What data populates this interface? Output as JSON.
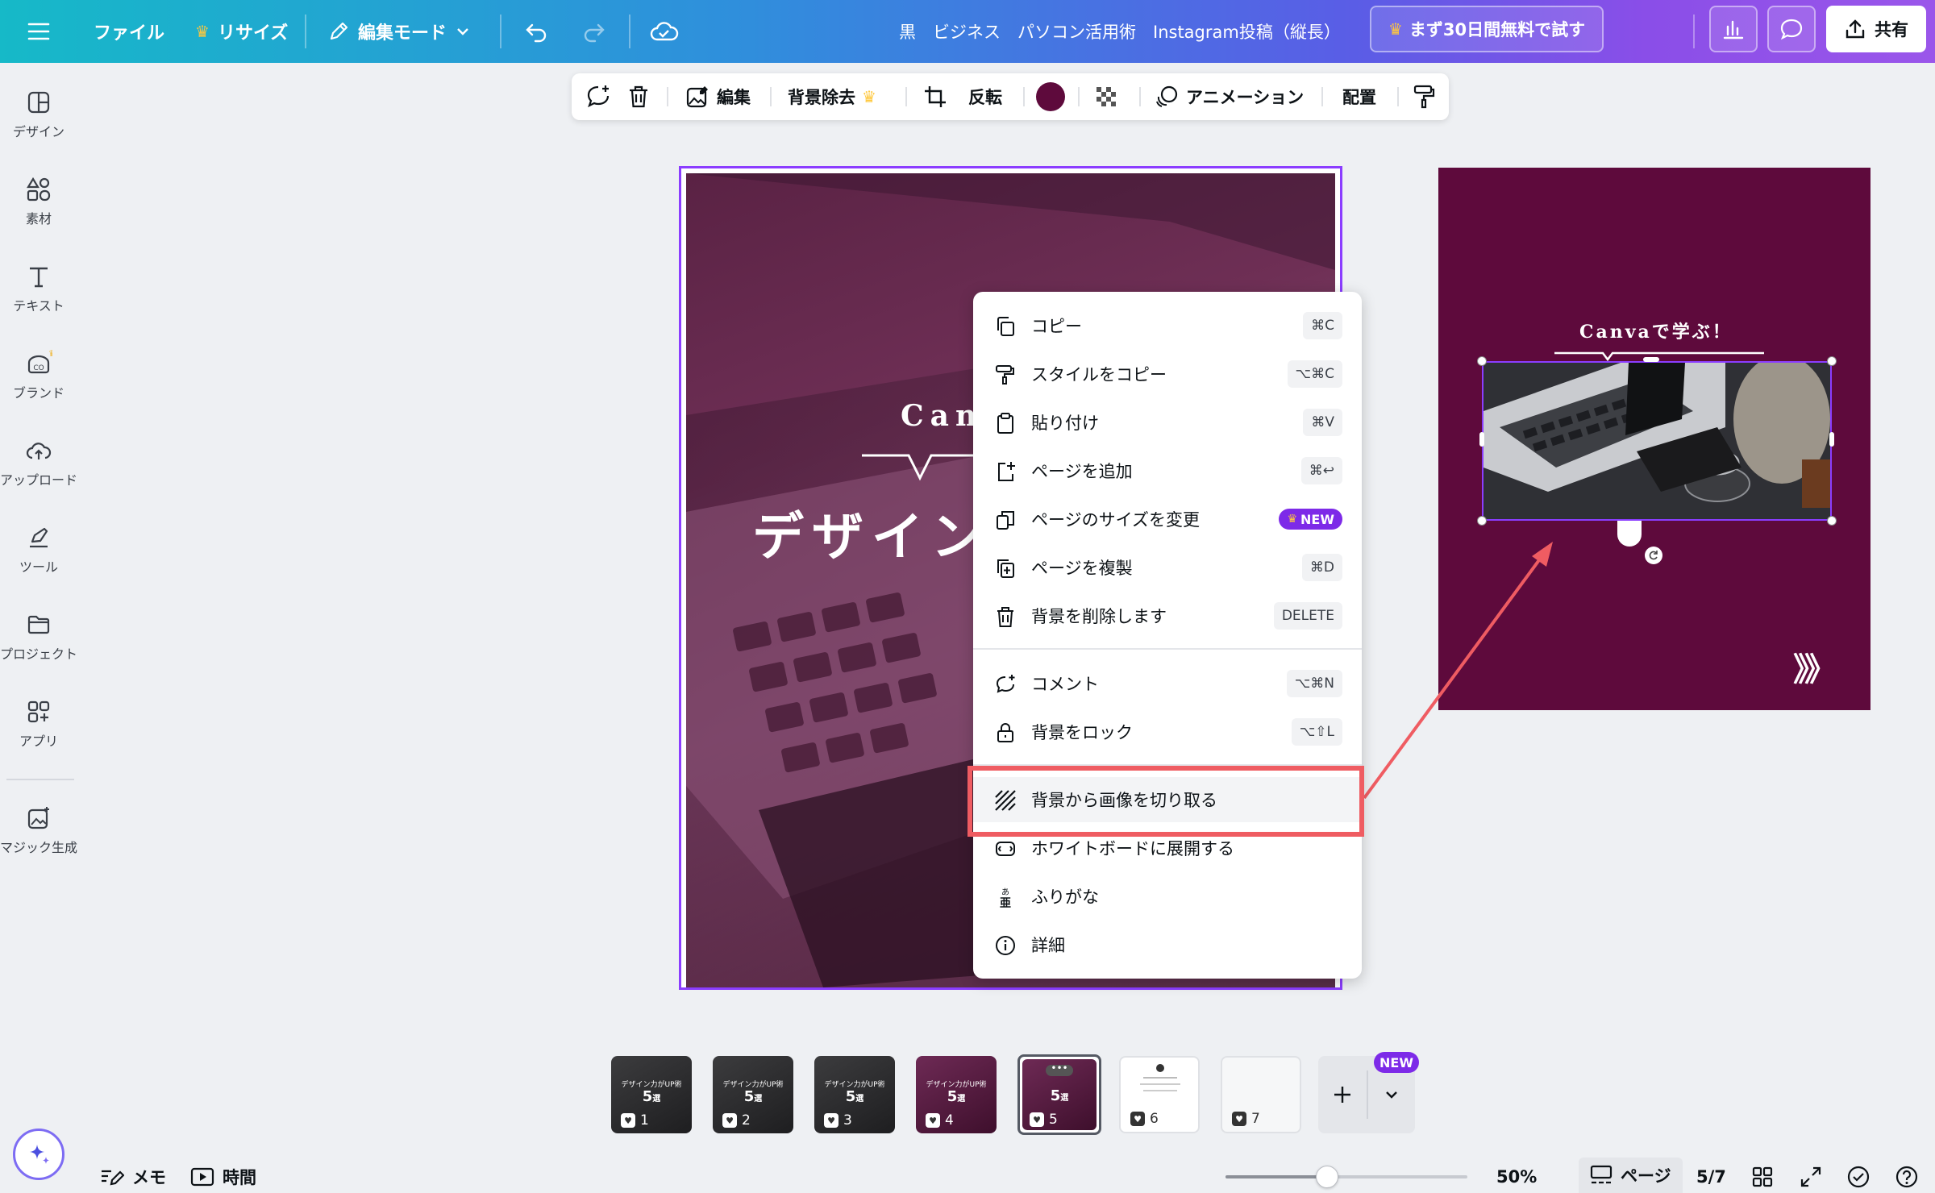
{
  "header": {
    "file": "ファイル",
    "resize": "リサイズ",
    "edit_mode": "編集モード",
    "doc_title": "黒　ビジネス　パソコン活用術　Instagram投稿（縦長）",
    "trial": "まず30日間無料で試す",
    "share": "共有"
  },
  "sidebar": {
    "design": "デザイン",
    "elements": "素材",
    "text": "テキスト",
    "brand": "ブランド",
    "upload": "アップロード",
    "tools": "ツール",
    "projects": "プロジェクト",
    "apps": "アプリ",
    "magic": "マジック生成"
  },
  "toolbar": {
    "edit": "編集",
    "bg_remove": "背景除去",
    "flip": "反転",
    "animation": "アニメーション",
    "position": "配置",
    "color": "#5e0a3c"
  },
  "canvas": {
    "page4_title_partial": "Canv",
    "page4_heading_partial": "デザイン",
    "page5_title": "Canvaで学ぶ！",
    "page5_arrows": "》》",
    "page5_bg": "#5e0a3c"
  },
  "menu": {
    "items": [
      {
        "label": "コピー",
        "shortcut": "⌘C"
      },
      {
        "label": "スタイルをコピー",
        "shortcut": "⌥⌘C"
      },
      {
        "label": "貼り付け",
        "shortcut": "⌘V"
      },
      {
        "label": "ページを追加",
        "shortcut": "⌘↩"
      },
      {
        "label": "ページのサイズを変更",
        "badge": "NEW"
      },
      {
        "label": "ページを複製",
        "shortcut": "⌘D"
      },
      {
        "label": "背景を削除します",
        "shortcut": "DELETE"
      },
      {
        "label": "コメント",
        "shortcut": "⌥⌘N"
      },
      {
        "label": "背景をロック",
        "shortcut": "⌥⇧L"
      },
      {
        "label": "背景から画像を切り取る"
      },
      {
        "label": "ホワイトボードに展開する"
      },
      {
        "label": "ふりがな"
      },
      {
        "label": "詳細"
      }
    ],
    "highlight_color": "#ef5c62"
  },
  "pages": {
    "thumbs": [
      "1",
      "2",
      "3",
      "4",
      "5",
      "6",
      "7"
    ],
    "thumb_title": "デザイン力がUP術",
    "thumb_big": "5",
    "thumb_unit": "選",
    "new_badge": "NEW"
  },
  "bottom": {
    "memo": "メモ",
    "time": "時間",
    "zoom": "50%",
    "page_label": "ページ",
    "page_count": "5/7"
  }
}
